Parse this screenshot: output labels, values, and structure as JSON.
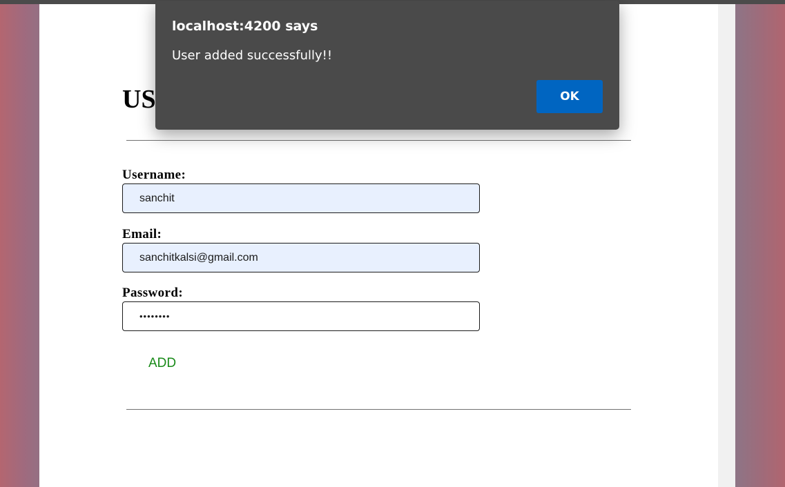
{
  "page": {
    "heading": "US"
  },
  "form": {
    "username": {
      "label": "Username:",
      "value": "sanchit"
    },
    "email": {
      "label": "Email:",
      "value": "sanchitkalsi@gmail.com"
    },
    "password": {
      "label": "Password:",
      "value": "••••••••"
    },
    "add_label": "ADD"
  },
  "dialog": {
    "title": "localhost:4200 says",
    "message": "User added successfully!!",
    "ok_label": "OK"
  },
  "colors": {
    "dialog_background": "#4a4a4a",
    "ok_button": "#0065c1",
    "add_button_text": "#188a18",
    "autofill_background": "#e8f0fe"
  }
}
